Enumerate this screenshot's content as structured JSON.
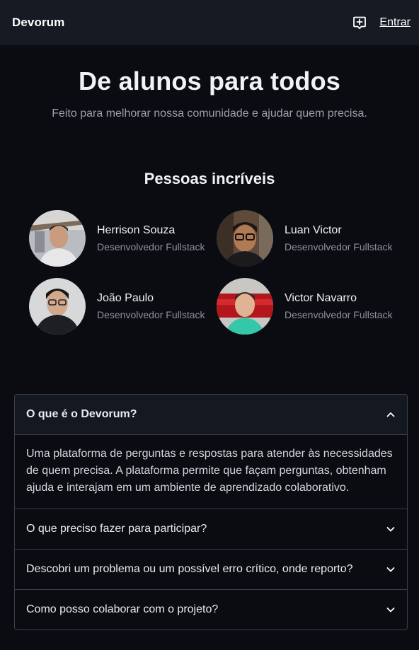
{
  "header": {
    "brand": "Devorum",
    "login_label": "Entrar",
    "new_post_icon": "add-comment-icon"
  },
  "hero": {
    "title": "De alunos para todos",
    "subtitle": "Feito para melhorar nossa comunidade e ajudar quem precisa."
  },
  "team": {
    "title": "Pessoas incríveis",
    "members": [
      {
        "name": "Herrison Souza",
        "role": "Desenvolvedor Fullstack"
      },
      {
        "name": "Luan Victor",
        "role": "Desenvolvedor Fullstack"
      },
      {
        "name": "João Paulo",
        "role": "Desenvolvedor Fullstack"
      },
      {
        "name": "Victor Navarro",
        "role": "Desenvolvedor Fullstack"
      }
    ]
  },
  "faq": {
    "items": [
      {
        "question": "O que é o Devorum?",
        "answer": "Uma plataforma de perguntas e respostas para atender às necessidades de quem precisa. A plataforma permite que façam perguntas, obtenham ajuda e interajam em um ambiente de aprendizado colaborativo.",
        "expanded": true
      },
      {
        "question": "O que preciso fazer para participar?",
        "expanded": false
      },
      {
        "question": "Descobri um problema ou um possível erro crítico, onde reporto?",
        "expanded": false
      },
      {
        "question": "Como posso colaborar com o projeto?",
        "expanded": false
      }
    ]
  },
  "colors": {
    "background": "#0a0c12",
    "header": "#161a22",
    "border": "#3a3f48"
  }
}
